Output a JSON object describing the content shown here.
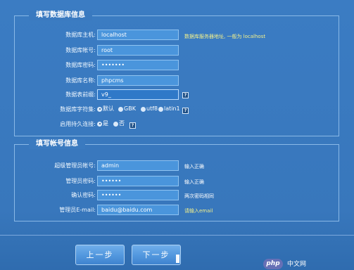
{
  "database_section": {
    "title": "填写数据库信息",
    "fields": [
      {
        "label": "数据库主机:",
        "value": "localhost",
        "hint": "数据库服务器地址, 一般为 localhost"
      },
      {
        "label": "数据库帐号:",
        "value": "root"
      },
      {
        "label": "数据库密码:",
        "value": "•••••••"
      },
      {
        "label": "数据库名称:",
        "value": "phpcms"
      },
      {
        "label": "数据表前缀:",
        "value": "v9_",
        "help_icon": "help-icon"
      }
    ],
    "charset": {
      "label": "数据库字符集:",
      "options": [
        {
          "label": "默认",
          "selected": true
        },
        {
          "label": "GBK",
          "selected": false
        },
        {
          "label": "utf8",
          "selected": false
        },
        {
          "label": "latin1",
          "selected": false
        }
      ],
      "help_icon": "help-icon"
    },
    "persistent": {
      "label": "启用持久连接:",
      "options": [
        {
          "label": "是",
          "selected": true
        },
        {
          "label": "否",
          "selected": false
        }
      ],
      "help_icon": "help-icon"
    }
  },
  "account_section": {
    "title": "填写帐号信息",
    "fields": [
      {
        "label": "超级管理员帐号:",
        "value": "admin",
        "hint": "输入正确"
      },
      {
        "label": "管理员密码:",
        "value": "••••••",
        "hint": "输入正确"
      },
      {
        "label": "确认密码:",
        "value": "••••••",
        "hint": "两次密码相同"
      },
      {
        "label": "管理员E-mail:",
        "value": "baidu@baidu.com",
        "hint": "请输入email"
      }
    ]
  },
  "buttons": {
    "previous": "上一步",
    "next": "下一步"
  },
  "watermark": {
    "logo": "php",
    "text": "中文网"
  },
  "colors": {
    "background": "#3a7ac0",
    "input": "#4a95dc",
    "hint_yellow": "#f2f08b"
  }
}
